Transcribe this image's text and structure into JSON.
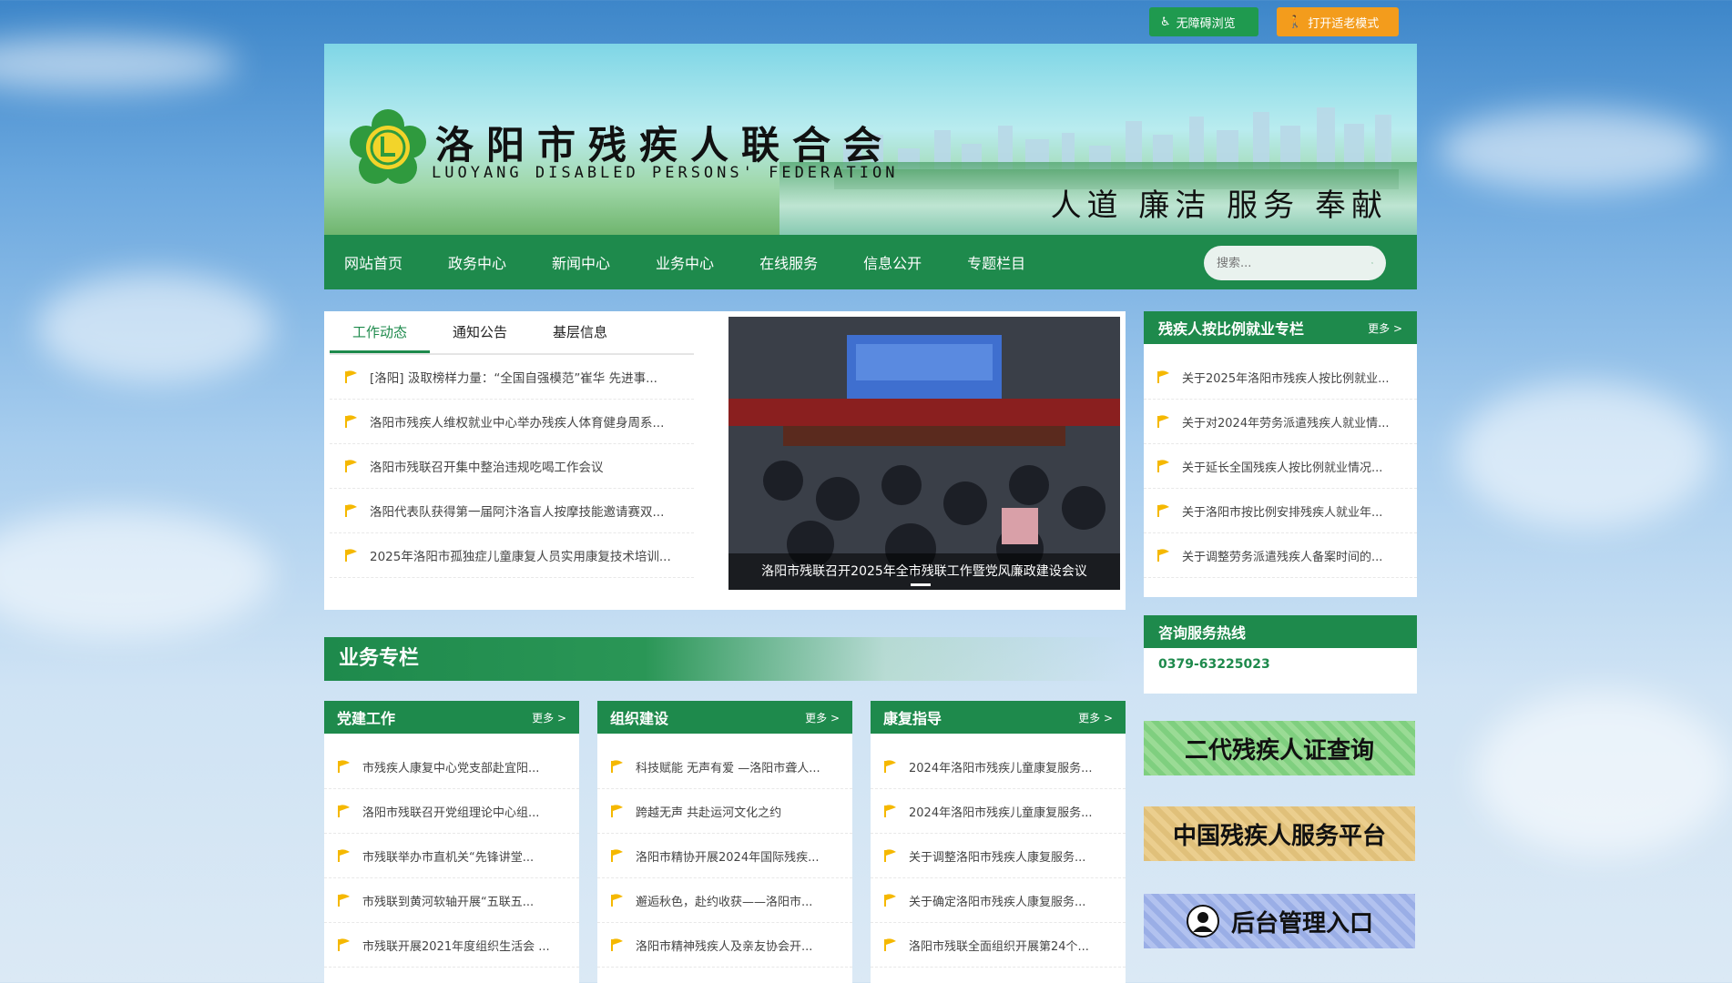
{
  "accessibility": {
    "barrier_free": "无障碍浏览",
    "elder_mode": "打开适老模式"
  },
  "header": {
    "title": "洛阳市残疾人联合会",
    "subtitle": "LUOYANG DISABLED PERSONS' FEDERATION",
    "slogan": "人道 廉洁 服务 奉献"
  },
  "nav": {
    "items": [
      "网站首页",
      "政务中心",
      "新闻中心",
      "业务中心",
      "在线服务",
      "信息公开",
      "专题栏目"
    ],
    "search_placeholder": "搜索..."
  },
  "news": {
    "tabs": [
      "工作动态",
      "通知公告",
      "基层信息"
    ],
    "items": [
      "[洛阳] 汲取榜样力量：“全国自强模范”崔华 先进事...",
      "洛阳市残疾人维权就业中心举办残疾人体育健身周系...",
      "洛阳市残联召开集中整治违规吃喝工作会议",
      "洛阳代表队获得第一届阿汴洛盲人按摩技能邀请赛双...",
      "2025年洛阳市孤独症儿童康复人员实用康复技术培训..."
    ],
    "slide_caption": "洛阳市残联召开2025年全市残联工作暨党风廉政建设会议"
  },
  "employment": {
    "title": "残疾人按比例就业专栏",
    "more": "更多 >",
    "items": [
      "关于2025年洛阳市残疾人按比例就业...",
      "关于对2024年劳务派遣残疾人就业情...",
      "关于延长全国残疾人按比例就业情况...",
      "关于洛阳市按比例安排残疾人就业年...",
      "关于调整劳务派遣残疾人备案时间的..."
    ]
  },
  "hotline": {
    "title": "咨询服务热线",
    "number": "0379-63225023"
  },
  "promos": [
    "二代残疾人证查询",
    "中国残疾人服务平台",
    "后台管理入口"
  ],
  "business": {
    "title": "业务专栏",
    "columns": [
      {
        "title": "党建工作",
        "more": "更多 >",
        "items": [
          "市残疾人康复中心党支部赴宜阳...",
          "洛阳市残联召开党组理论中心组...",
          "市残联举办市直机关“先锋讲堂...",
          "市残联到黄河软轴开展“五联五...",
          "市残联开展2021年度组织生活会 ..."
        ]
      },
      {
        "title": "组织建设",
        "more": "更多 >",
        "items": [
          "科技赋能 无声有爱 —洛阳市聋人...",
          "跨越无声 共赴运河文化之约",
          "洛阳市精协开展2024年国际残疾...",
          "邂逅秋色，赴约收获——洛阳市...",
          "洛阳市精神残疾人及亲友协会开..."
        ]
      },
      {
        "title": "康复指导",
        "more": "更多 >",
        "items": [
          "2024年洛阳市残疾儿童康复服务...",
          "2024年洛阳市残疾儿童康复服务...",
          "关于调整洛阳市残疾人康复服务...",
          "关于确定洛阳市残疾人康复服务...",
          "洛阳市残联全面组织开展第24个..."
        ]
      }
    ]
  },
  "colors": {
    "primary_green": "#1e8a4c",
    "orange": "#f39c1c",
    "flag_yellow": "#f5b800"
  }
}
